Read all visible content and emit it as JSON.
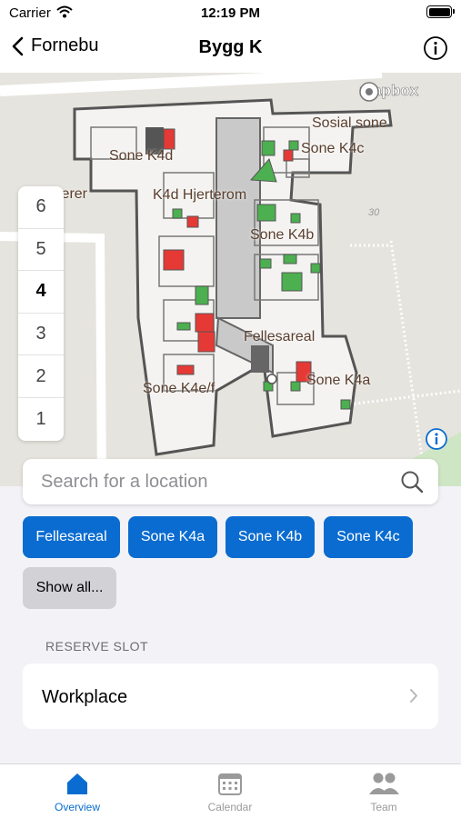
{
  "status_bar": {
    "carrier": "Carrier",
    "time": "12:19 PM"
  },
  "nav": {
    "back_label": "Fornebu",
    "title": "Bygg K"
  },
  "map": {
    "attribution": "mapbox",
    "labels": {
      "sosial_sone": "Sosial sone",
      "sone_k4c": "Sone K4c",
      "sone_k4d": "Sone K4d",
      "k4d_hjerterom": "K4d Hjerterom",
      "sone_k4b": "Sone K4b",
      "fellesareal": "Fellesareal",
      "sone_k4a": "Sone K4a",
      "sone_k4e_f": "Sone K4e/f",
      "number_30": "30",
      "partial_label": "lerer"
    },
    "floors": [
      "6",
      "5",
      "4",
      "3",
      "2",
      "1"
    ],
    "selected_floor": "4"
  },
  "search": {
    "placeholder": "Search for a location"
  },
  "chips": [
    "Fellesareal",
    "Sone K4a",
    "Sone K4b",
    "Sone K4c",
    "Show all..."
  ],
  "reserve": {
    "section_label": "RESERVE SLOT",
    "row_label": "Workplace"
  },
  "tabs": [
    {
      "label": "Overview",
      "icon": "home-icon",
      "active": true
    },
    {
      "label": "Calendar",
      "icon": "calendar-icon",
      "active": false
    },
    {
      "label": "Team",
      "icon": "team-icon",
      "active": false
    }
  ],
  "colors": {
    "accent": "#0a6cd0",
    "available": "#4caf50",
    "occupied": "#e53935"
  }
}
